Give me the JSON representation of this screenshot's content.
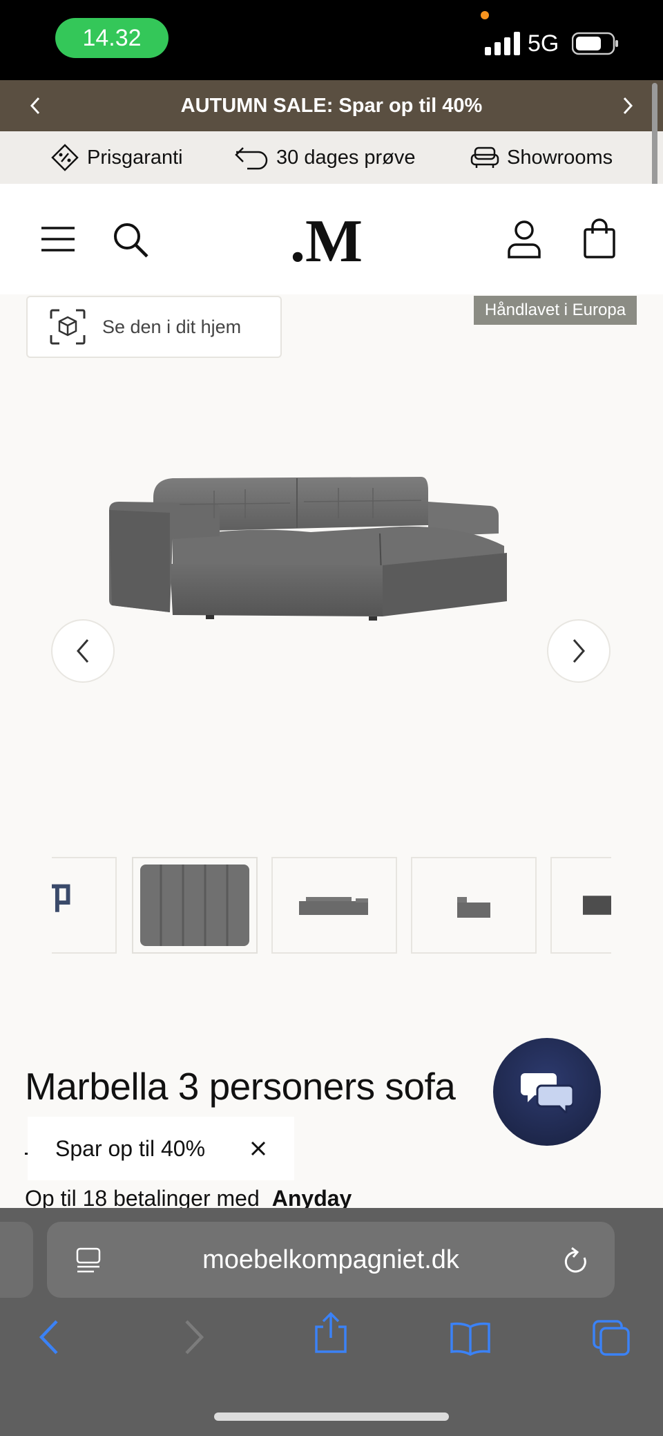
{
  "status_bar": {
    "time": "14.32",
    "network": "5G"
  },
  "sale_banner": {
    "text": "AUTUMN SALE: Spar op til 40%"
  },
  "usp": [
    {
      "label": "Prisgaranti",
      "icon": "price-tag-icon"
    },
    {
      "label": "30 dages prøve",
      "icon": "return-arrow-icon"
    },
    {
      "label": "Showrooms",
      "icon": "sofa-icon"
    }
  ],
  "header": {
    "logo": ".M"
  },
  "product": {
    "ar_button_label": "Se den i dit hjem",
    "badge": "Håndlavet i Europa",
    "title": "Marbella 3 personers sofa",
    "toast": "Spar op til 40%",
    "payment_text": "Op til 18 betalinger med",
    "payment_brand": "Anyday"
  },
  "safari": {
    "url": "moebelkompagniet.dk"
  },
  "colors": {
    "sale_banner": "#5a4f41",
    "status_green": "#34c759",
    "chat_button": "#1e2850",
    "safari_blue": "#3b82f6"
  }
}
